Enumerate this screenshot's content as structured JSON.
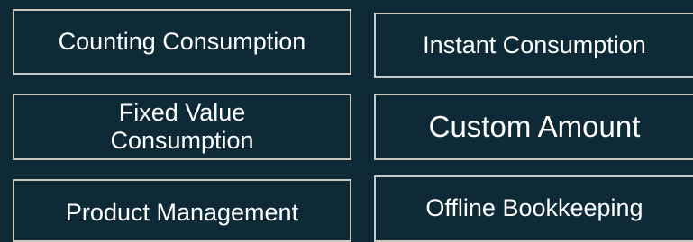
{
  "menu": {
    "tiles": [
      {
        "id": "counting",
        "label": "Counting Consumption"
      },
      {
        "id": "instant",
        "label": "Instant Consumption"
      },
      {
        "id": "fixed-value",
        "label": "Fixed Value Consumption"
      },
      {
        "id": "custom-amount",
        "label": "Custom Amount"
      },
      {
        "id": "product-management",
        "label": "Product Management"
      },
      {
        "id": "offline-bookkeeping",
        "label": "Offline Bookkeeping"
      }
    ]
  },
  "colors": {
    "background": "#0d2a36",
    "tile_border": "#c9c9c2",
    "text": "#ffffff"
  }
}
